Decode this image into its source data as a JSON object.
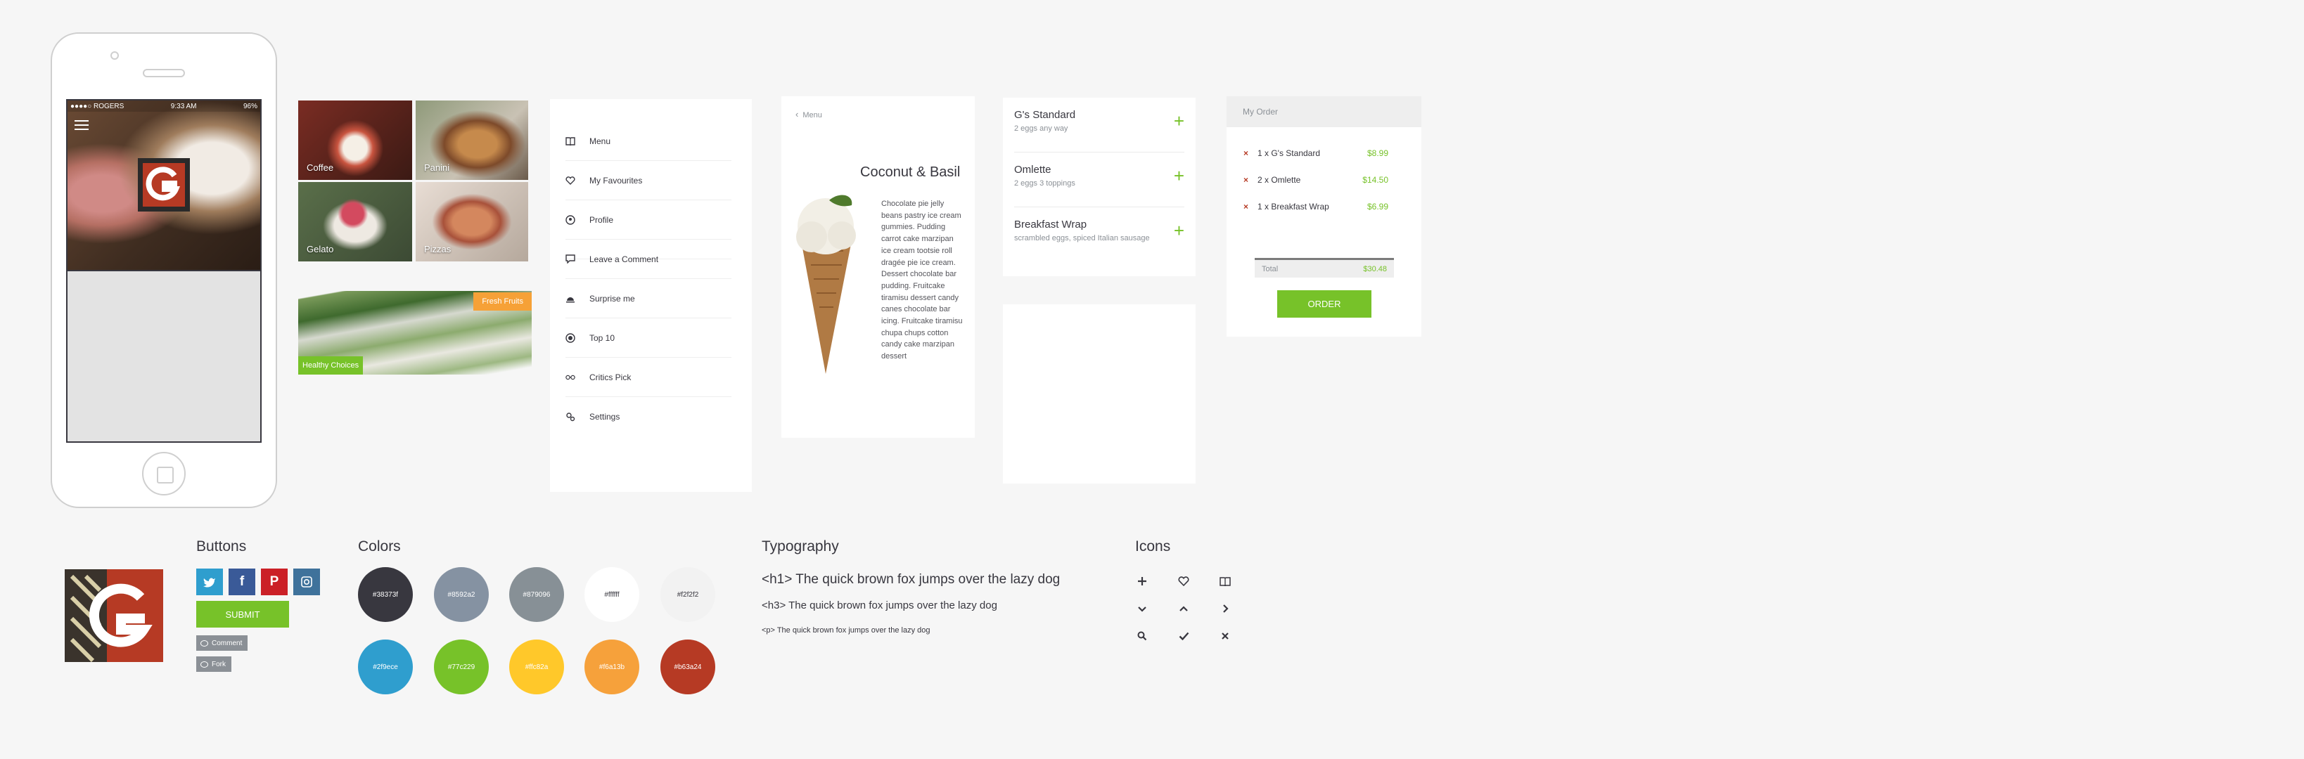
{
  "phone": {
    "status_carrier": "●●●●○ ROGERS",
    "status_time": "9:33 AM",
    "status_battery": "96%"
  },
  "tiles": [
    {
      "label": "Coffee"
    },
    {
      "label": "Panini"
    },
    {
      "label": "Gelato"
    },
    {
      "label": "Pizzas"
    }
  ],
  "healthy": {
    "badge": "Fresh Fruits",
    "label": "Healthy Choices"
  },
  "menu": {
    "items": [
      {
        "label": "Menu",
        "icon": "book-icon"
      },
      {
        "label": "My Favourites",
        "icon": "heart-icon"
      },
      {
        "label": "Profile",
        "icon": "profile-icon"
      },
      {
        "label": "Leave a Comment",
        "icon": "comment-icon"
      },
      {
        "label": "Surprise me",
        "icon": "cloche-icon"
      },
      {
        "label": "Top 10",
        "icon": "target-icon"
      },
      {
        "label": "Critics Pick",
        "icon": "glasses-icon"
      },
      {
        "label": "Settings",
        "icon": "settings-icon"
      }
    ]
  },
  "detail": {
    "back_label": "Menu",
    "title": "Coconut & Basil",
    "description": "Chocolate pie jelly beans pastry ice cream gummies. Pudding carrot cake marzipan ice cream tootsie roll dragée pie ice cream. Dessert chocolate bar pudding. Fruitcake tiramisu dessert candy canes chocolate bar icing. Fruitcake tiramisu chupa chups cotton candy cake marzipan dessert"
  },
  "order_list": [
    {
      "name": "G's Standard",
      "sub": "2 eggs any way"
    },
    {
      "name": "Omlette",
      "sub": "2 eggs 3 toppings"
    },
    {
      "name": "Breakfast Wrap",
      "sub": "scrambled eggs, spiced Italian sausage"
    }
  ],
  "my_order": {
    "title": "My Order",
    "items": [
      {
        "label": "1 x G's Standard",
        "price": "$8.99"
      },
      {
        "label": "2 x Omlette",
        "price": "$14.50"
      },
      {
        "label": "1 x Breakfast Wrap",
        "price": "$6.99"
      }
    ],
    "total_label": "Total",
    "total_value": "$30.48",
    "button": "ORDER"
  },
  "styleguide": {
    "buttons_title": "Buttons",
    "submit": "SUBMIT",
    "comment": "Comment",
    "fork": "Fork",
    "colors_title": "Colors",
    "colors": [
      {
        "hex": "#38373f",
        "label": "#38373f"
      },
      {
        "hex": "#8592a2",
        "label": "#8592a2"
      },
      {
        "hex": "#879096",
        "label": "#879096"
      },
      {
        "hex": "#ffffff",
        "label": "#ffffff"
      },
      {
        "hex": "#f2f2f2",
        "label": "#f2f2f2"
      },
      {
        "hex": "#2f9ece",
        "label": "#2f9ece"
      },
      {
        "hex": "#77c229",
        "label": "#77c229"
      },
      {
        "hex": "#ffc82a",
        "label": "#ffc82a"
      },
      {
        "hex": "#f6a13b",
        "label": "#f6a13b"
      },
      {
        "hex": "#b63a24",
        "label": "#b63a24"
      }
    ],
    "typography_title": "Typography",
    "h1": "<h1> The quick brown fox jumps over the lazy dog",
    "h3": "<h3> The quick brown fox jumps over the lazy dog",
    "p": "<p> The quick brown fox jumps over the lazy dog",
    "icons_title": "Icons"
  }
}
